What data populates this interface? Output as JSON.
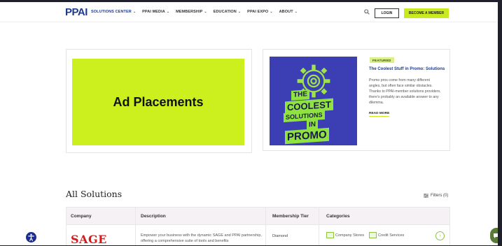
{
  "nav": {
    "logo": "PPAI",
    "items": [
      {
        "label": "SOLUTIONS CENTER",
        "active": true
      },
      {
        "label": "PPAI MEDIA",
        "active": false
      },
      {
        "label": "MEMBERSHIP",
        "active": false
      },
      {
        "label": "EDUCATION",
        "active": false
      },
      {
        "label": "PPAI EXPO",
        "active": false
      },
      {
        "label": "ABOUT",
        "active": false
      }
    ],
    "login_label": "LOGIN",
    "join_label": "BECOME A MEMBER"
  },
  "hero": {
    "ad_title": "Ad Placements",
    "promo_image_lines": [
      "THE",
      "COOLEST",
      "SOLUTIONS",
      "IN",
      "PROMO"
    ],
    "featured_badge": "FEATURED",
    "article_title": "The Coolest Stuff in Promo: Solutions",
    "article_body": "Promo pros come from many different angles, but often face similar obstacles. Thanks to PPAI-member solutions providers, there's probably an available answer to any dilemma.",
    "read_more": "READ MORE"
  },
  "solutions": {
    "title": "All Solutions",
    "filters_label": "Filters (0)",
    "columns": [
      "Company",
      "Description",
      "Membership Tier",
      "Categories"
    ],
    "rows": [
      {
        "company_logo_text": "SAGE",
        "description": "Empower your business with the dynamic SAGE and PPAI partnership, offering a comprehensive suite of tools and benefits",
        "tier": "Diamond",
        "categories": [
          "Company Stores",
          "Credit Services"
        ]
      }
    ]
  },
  "colors": {
    "accent_lime": "#ccef1e",
    "brand_blue": "#1b3b8f",
    "promo_purple": "#3c3fb3",
    "sage_red": "#d8191a"
  },
  "icons": [
    "search-icon",
    "chevron-down-icon",
    "filter-icon",
    "gear-icon",
    "accessibility-icon",
    "chat-icon",
    "arrow-right-icon"
  ]
}
